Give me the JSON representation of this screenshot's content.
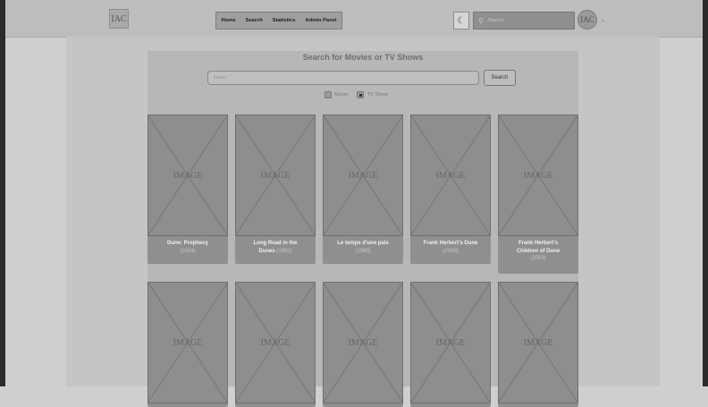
{
  "header": {
    "logo_text": "IAC",
    "nav": [
      "Home",
      "Search",
      "Statistics",
      "Admin Panel"
    ],
    "theme_icon": "moon-icon",
    "search_placeholder": "Search...",
    "avatar_text": "IAC"
  },
  "search_page": {
    "title": "Search for Movies or TV Shows",
    "query": "Dune",
    "search_button": "Search",
    "type_options": [
      {
        "label": "Movie",
        "selected": false
      },
      {
        "label": "TV Show",
        "selected": true
      }
    ]
  },
  "results": [
    {
      "title": "Dune: Prophecy",
      "year": "(2024)",
      "poster_text": "IMAGE"
    },
    {
      "title_line1": "Long Road in the",
      "title_line2": "Dunes",
      "year": "(1982)",
      "poster_text": "IMAGE"
    },
    {
      "title": "Le temps d'une paix",
      "year": "(1980)",
      "poster_text": "IMAGE"
    },
    {
      "title": "Frank Herbert's Dune",
      "year": "(2000)",
      "poster_text": "IMAGE"
    },
    {
      "title_line1": "Frank Herbert's",
      "title_line2": "Children of Dune",
      "year": "(2003)",
      "poster_text": "IMAGE"
    },
    {
      "poster_text": "IMAGE"
    },
    {
      "poster_text": "IMAGE"
    },
    {
      "poster_text": "IMAGE"
    },
    {
      "poster_text": "IMAGE"
    },
    {
      "poster_text": "IMAGE"
    }
  ]
}
